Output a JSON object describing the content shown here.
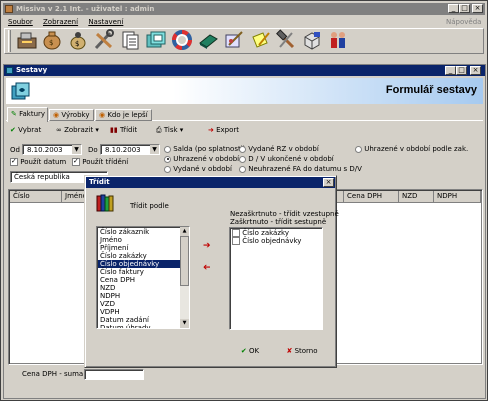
{
  "app": {
    "title": "Missiva v 2.1 Int. - uživatel : admin",
    "help": "Nápověda"
  },
  "menu": [
    {
      "label": "Soubor",
      "key": "S"
    },
    {
      "label": "Zobrazení",
      "key": "Z"
    },
    {
      "label": "Nastavení",
      "key": "N"
    }
  ],
  "toolbar_icons": [
    "cash-register-icon",
    "money-bag-icon",
    "coin-bag-icon",
    "tools-icon",
    "documents-icon",
    "folders-icon",
    "lifebuoy-icon",
    "book-icon",
    "edit-note-icon",
    "note-pencil-icon",
    "hammer-icon",
    "package-icon",
    "users-icon"
  ],
  "window": {
    "title": "Sestavy",
    "heading": "Formulář sestavy"
  },
  "tabs": [
    {
      "label": "Faktury"
    },
    {
      "label": "Výrobky"
    },
    {
      "label": "Kdo je lepší"
    }
  ],
  "actions": {
    "select": "Vybrat",
    "view": "Zobrazit",
    "sort": "Třídit",
    "print": "Tisk",
    "export": "Export"
  },
  "filter": {
    "od_label": "Od",
    "od_value": "8.10.2003",
    "do_label": "Do",
    "do_value": "8.10.2003",
    "use_date": "Použít datum",
    "use_sort": "Použít třídění",
    "country": "Česká republika",
    "radios": [
      {
        "label": "Salda (po splatnosti)",
        "checked": false
      },
      {
        "label": "Uhrazené v období",
        "checked": true
      },
      {
        "label": "Vydané v období",
        "checked": false
      },
      {
        "label": "Vydané RZ v období",
        "checked": false
      },
      {
        "label": "D / V ukončené v období",
        "checked": false
      },
      {
        "label": "Neuhrazené FA do datumu s D/V",
        "checked": false
      },
      {
        "label": "Uhrazené v období podle zak.",
        "checked": false
      }
    ]
  },
  "grid": {
    "columns": [
      "Číslo zákazníka",
      "Jméno",
      "Cena DPH",
      "NZD",
      "NDPH"
    ],
    "footer": "Cena DPH - suma"
  },
  "dialog": {
    "title": "Třídit",
    "subtitle": "Třídit podle",
    "right_caption_1": "Nezaškrtnuto - třídit vzestupně",
    "right_caption_2": "Zaškrtnuto - třídit sestupně",
    "available": [
      "Číslo zákazník",
      "Jméno",
      "Příjmení",
      "Číslo zakázky",
      "Číslo objednávky",
      "Číslo faktury",
      "Cena DPH",
      "NZD",
      "NDPH",
      "VZD",
      "VDPH",
      "Datum zadání",
      "Datum úhrady"
    ],
    "selected_index": 4,
    "chosen": [
      {
        "label": "Číslo zakázky",
        "checked": false
      },
      {
        "label": "Číslo objednávky",
        "checked": false
      }
    ],
    "ok": "OK",
    "cancel": "Storno"
  },
  "colors": {
    "title_active": "#0a246a",
    "title_inactive": "#808080",
    "face": "#d4d0c8",
    "heading_grad": "#a6caf0",
    "arrow_red": "#c00000",
    "ok_green": "#008000",
    "cancel_red": "#c00000"
  }
}
